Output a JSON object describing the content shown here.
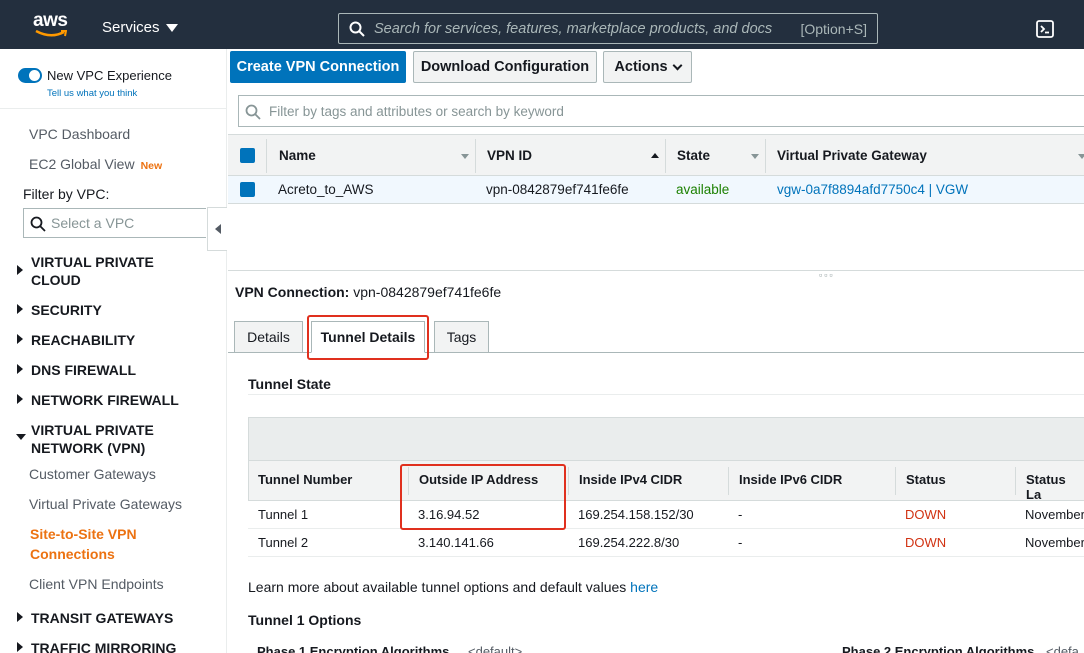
{
  "topnav": {
    "logo": "aws",
    "services_label": "Services",
    "search_placeholder": "Search for services, features, marketplace products, and docs",
    "search_shortcut": "[Option+S]"
  },
  "sidebar": {
    "new_vpc_label": "New VPC Experience",
    "tell_us_label": "Tell us what you think",
    "vpc_dashboard": "VPC Dashboard",
    "ec2_global_view": "EC2 Global View",
    "new_badge": "New",
    "filter_label": "Filter by VPC:",
    "filter_placeholder": "Select a VPC",
    "sections": {
      "virtual_private_cloud_1": "VIRTUAL PRIVATE",
      "virtual_private_cloud_2": "CLOUD",
      "security": "SECURITY",
      "reachability": "REACHABILITY",
      "dns_firewall": "DNS FIREWALL",
      "network_firewall": "NETWORK FIREWALL",
      "vpn_1": "VIRTUAL PRIVATE",
      "vpn_2": "NETWORK (VPN)",
      "transit_gateways": "TRANSIT GATEWAYS",
      "traffic_mirroring": "TRAFFIC MIRRORING"
    },
    "vpn_items": {
      "customer_gateways": "Customer Gateways",
      "virtual_private_gateways": "Virtual Private Gateways",
      "site_to_site_1": "Site-to-Site VPN",
      "site_to_site_2": "Connections",
      "client_vpn": "Client VPN Endpoints"
    }
  },
  "toolbar": {
    "create_label": "Create VPN Connection",
    "download_label": "Download Configuration",
    "actions_label": "Actions",
    "filter_placeholder": "Filter by tags and attributes or search by keyword"
  },
  "grid": {
    "headers": {
      "name": "Name",
      "vpn_id": "VPN ID",
      "state": "State",
      "vpg": "Virtual Private Gateway"
    },
    "row": {
      "name": "Acreto_to_AWS",
      "vpn_id": "vpn-0842879ef741fe6fe",
      "state": "available",
      "vpg": "vgw-0a7f8894afd7750c4 | VGW"
    }
  },
  "detail": {
    "title_label": "VPN Connection:",
    "title_value": "vpn-0842879ef741fe6fe",
    "tabs": {
      "details": "Details",
      "tunnel_details": "Tunnel Details",
      "tags": "Tags"
    },
    "tunnel_state_title": "Tunnel State",
    "tunnel_headers": {
      "number": "Tunnel Number",
      "outside_ip": "Outside IP Address",
      "ipv4": "Inside IPv4 CIDR",
      "ipv6": "Inside IPv6 CIDR",
      "status": "Status",
      "status_last": "Status La"
    },
    "tunnels": [
      {
        "number": "Tunnel 1",
        "outside_ip": "3.16.94.52",
        "ipv4": "169.254.158.152/30",
        "ipv6": "-",
        "status": "DOWN",
        "last": "November"
      },
      {
        "number": "Tunnel 2",
        "outside_ip": "3.140.141.66",
        "ipv4": "169.254.222.8/30",
        "ipv6": "-",
        "status": "DOWN",
        "last": "November"
      }
    ],
    "learn_more": "Learn more about available tunnel options and default values",
    "learn_more_link": "here",
    "tunnel1_options_title": "Tunnel 1 Options",
    "phase1_label": "Phase 1 Encryption Algorithms",
    "phase1_value": "<default>",
    "phase2_label": "Phase 2 Encryption Algorithms",
    "phase2_value": "<defa"
  },
  "colors": {
    "topnav": "#232f3e",
    "primary": "#0073bb",
    "active_nav": "#ec7211",
    "highlight": "#e0301e",
    "down": "#d13212",
    "available": "#1d8102"
  }
}
